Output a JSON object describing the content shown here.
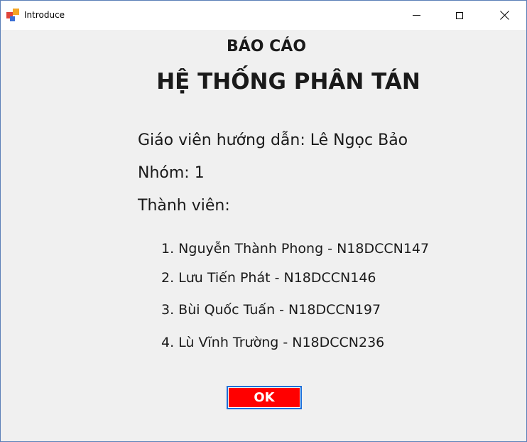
{
  "window": {
    "title": "Introduce",
    "icon": "app-icon",
    "buttons": [
      "minimize-icon",
      "maximize-icon",
      "close-icon"
    ]
  },
  "content": {
    "report_heading": "BÁO CÁO",
    "system_title": "HỆ THỐNG PHÂN TÁN",
    "advisor": "Giáo viên hướng dẫn: Lê Ngọc Bảo",
    "group": "Nhóm: 1",
    "members_label": "Thành viên:",
    "members": [
      "1. Nguyễn Thành Phong - N18DCCN147",
      "2. Lưu Tiến Phát - N18DCCN146",
      "3. Bùi Quốc Tuấn - N18DCCN197",
      "4. Lù Vĩnh Trường - N18DCCN236"
    ],
    "ok_label": "OK"
  },
  "colors": {
    "ok_background": "#ff0000",
    "ok_text": "#ffffff",
    "ok_focus_border": "#1e6fd9",
    "icon_red": "#e0443a",
    "icon_orange": "#f5a623",
    "icon_blue": "#3b6fd6"
  }
}
